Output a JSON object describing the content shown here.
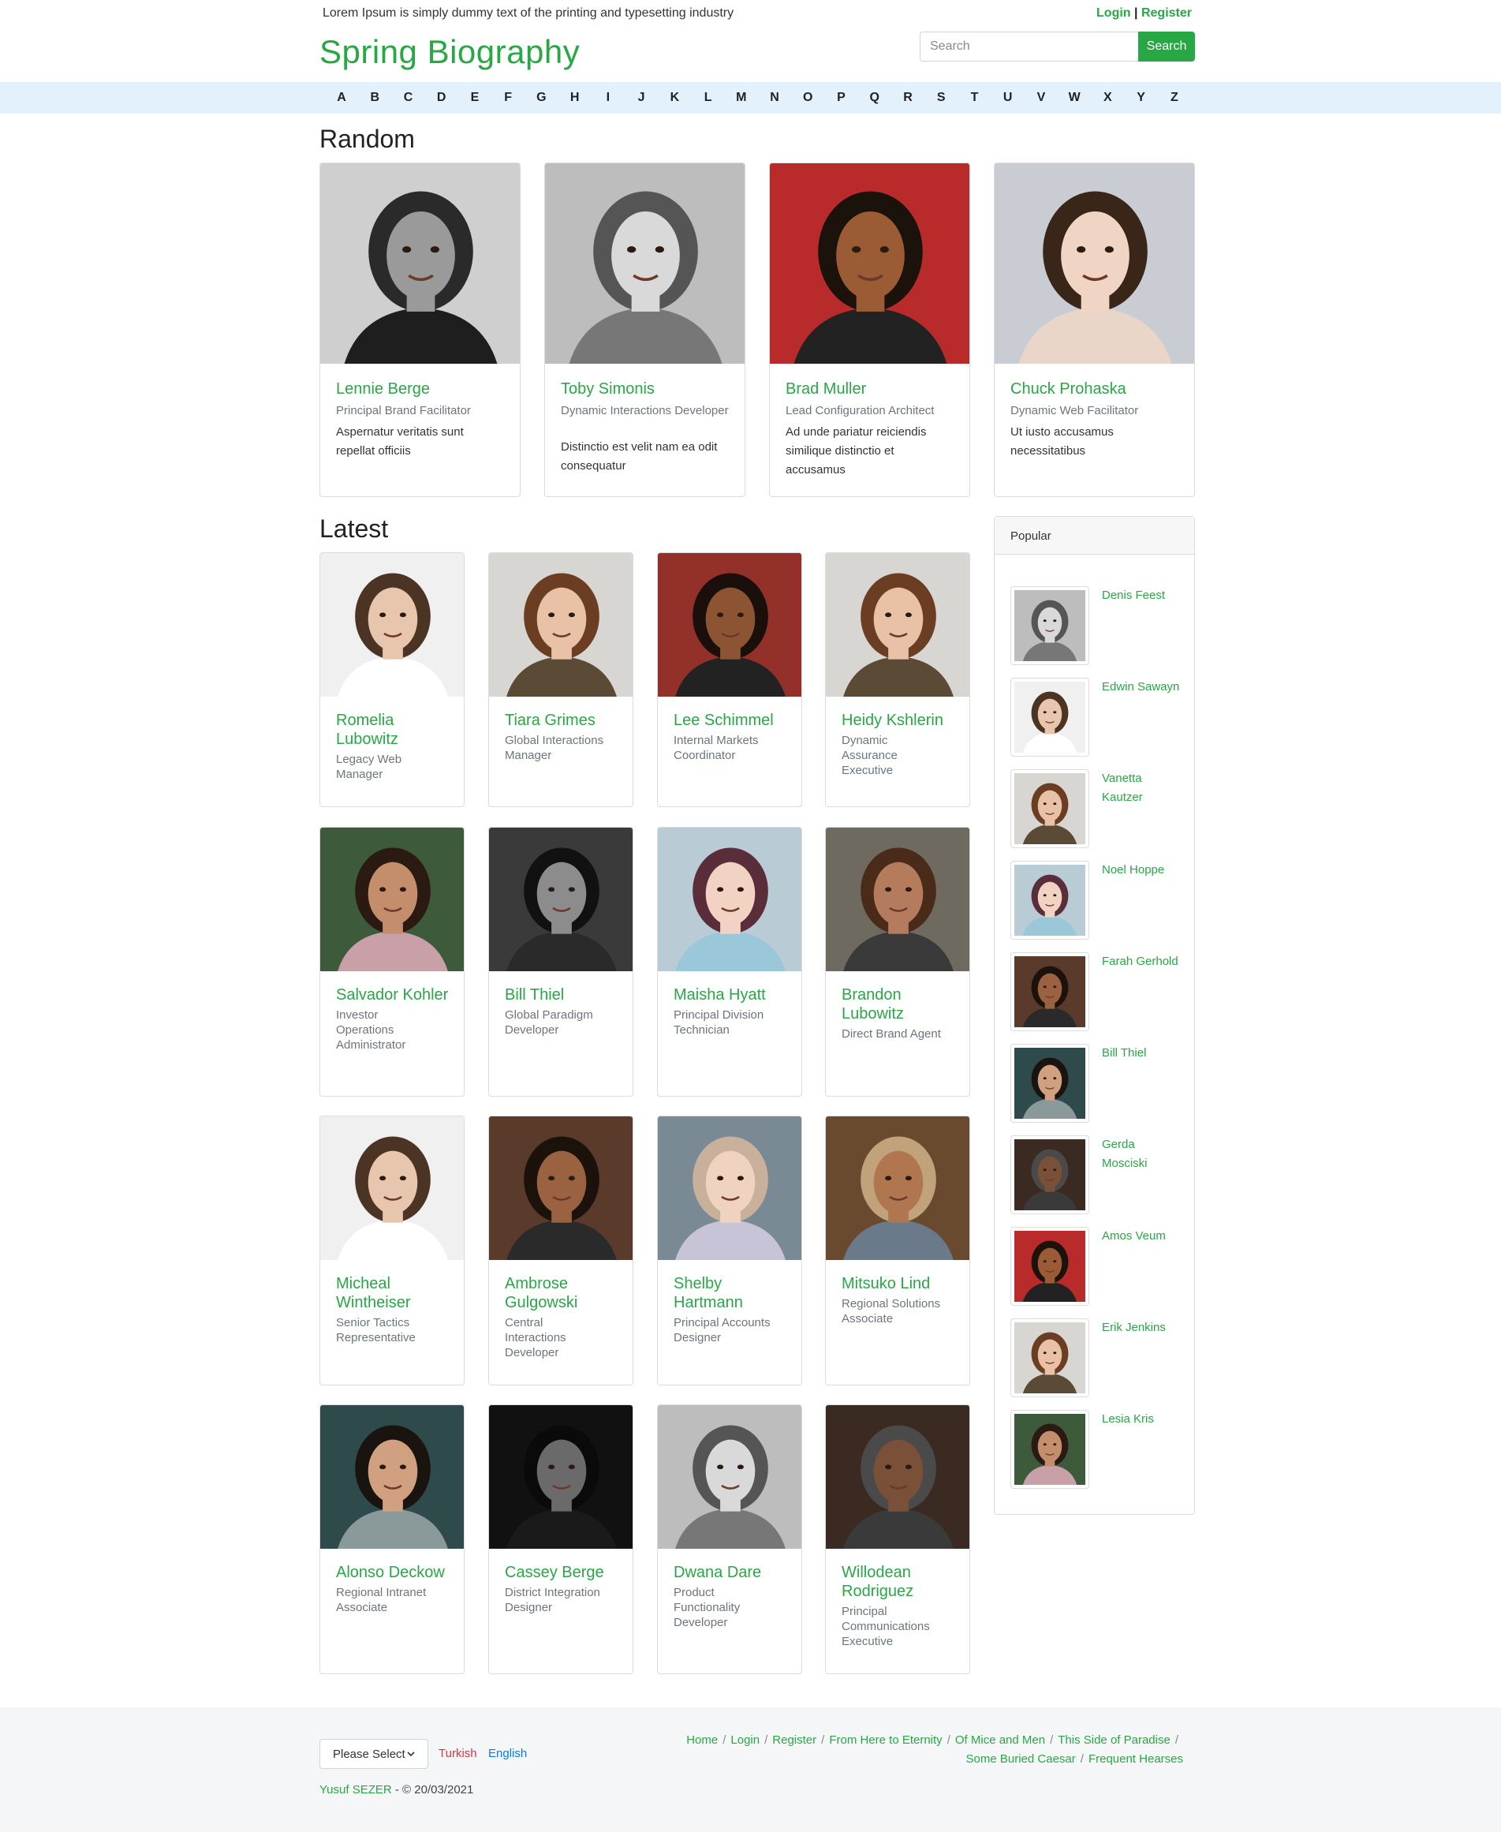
{
  "topbar": {
    "tagline": "Lorem Ipsum is simply dummy text of the printing and typesetting industry",
    "login": "Login",
    "separator": "|",
    "register": "Register"
  },
  "header": {
    "brand": "Spring Biography",
    "search_placeholder": "Search",
    "search_button": "Search"
  },
  "alphabet": [
    "A",
    "B",
    "C",
    "D",
    "E",
    "F",
    "G",
    "H",
    "I",
    "J",
    "K",
    "L",
    "M",
    "N",
    "O",
    "P",
    "Q",
    "R",
    "S",
    "T",
    "U",
    "V",
    "W",
    "X",
    "Y",
    "Z"
  ],
  "random": {
    "title": "Random",
    "people": [
      {
        "name": "Lennie Berge",
        "role": "Principal Brand Facilitator",
        "desc": "Aspernatur veritatis sunt repellat officiis"
      },
      {
        "name": "Toby Simonis",
        "role": "Dynamic Interactions Developer",
        "desc": "Distinctio est velit nam ea odit consequatur"
      },
      {
        "name": "Brad Muller",
        "role": "Lead Configuration Architect",
        "desc": "Ad unde pariatur reiciendis similique distinctio et accusamus"
      },
      {
        "name": "Chuck Prohaska",
        "role": "Dynamic Web Facilitator",
        "desc": "Ut iusto accusamus necessitatibus"
      }
    ]
  },
  "latest": {
    "title": "Latest",
    "people": [
      {
        "name": "Romelia Lubowitz",
        "role": "Legacy Web Manager"
      },
      {
        "name": "Tiara Grimes",
        "role": "Global Interactions Manager"
      },
      {
        "name": "Lee Schimmel",
        "role": "Internal Markets Coordinator"
      },
      {
        "name": "Heidy Kshlerin",
        "role": "Dynamic Assurance Executive"
      },
      {
        "name": "Salvador Kohler",
        "role": "Investor Operations Administrator"
      },
      {
        "name": "Bill Thiel",
        "role": "Global Paradigm Developer"
      },
      {
        "name": "Maisha Hyatt",
        "role": "Principal Division Technician"
      },
      {
        "name": "Brandon Lubowitz",
        "role": "Direct Brand Agent"
      },
      {
        "name": "Micheal Wintheiser",
        "role": "Senior Tactics Representative"
      },
      {
        "name": "Ambrose Gulgowski",
        "role": "Central Interactions Developer"
      },
      {
        "name": "Shelby Hartmann",
        "role": "Principal Accounts Designer"
      },
      {
        "name": "Mitsuko Lind",
        "role": "Regional Solutions Associate"
      },
      {
        "name": "Alonso Deckow",
        "role": "Regional Intranet Associate"
      },
      {
        "name": "Cassey Berge",
        "role": "District Integration Designer"
      },
      {
        "name": "Dwana Dare",
        "role": "Product Functionality Developer"
      },
      {
        "name": "Willodean Rodriguez",
        "role": "Principal Communications Executive"
      }
    ]
  },
  "popular": {
    "title": "Popular",
    "people": [
      "Denis Feest",
      "Edwin Sawayn",
      "Vanetta Kautzer",
      "Noel Hoppe",
      "Farah Gerhold",
      "Bill Thiel",
      "Gerda Mosciski",
      "Amos Veum",
      "Erik Jenkins",
      "Lesia Kris"
    ]
  },
  "footer": {
    "select_label": "Please Select",
    "lang_turkish": "Turkish",
    "lang_english": "English",
    "author": "Yusuf SEZER",
    "copyright": "- © 20/03/2021",
    "links": [
      "Home",
      "Login",
      "Register",
      "From Here to Eternity",
      "Of Mice and Men",
      "This Side of Paradise",
      "Some Buried Caesar",
      "Frequent Hearses"
    ]
  },
  "colors": {
    "accent": "#28a745",
    "alpha_bar": "#e3f1fc",
    "footer_bg": "#f5f6f8"
  }
}
